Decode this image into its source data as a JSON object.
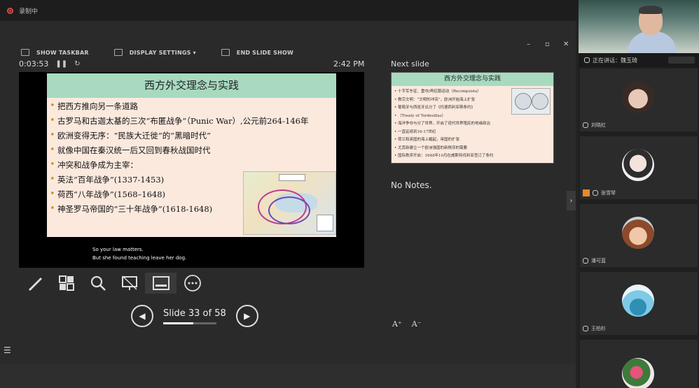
{
  "topbar": {
    "title": "录制中"
  },
  "toolbar": {
    "show_taskbar": "SHOW TASKBAR",
    "display_settings": "DISPLAY SETTINGS ▾",
    "end_slide_show": "END SLIDE SHOW"
  },
  "timer": {
    "elapsed": "0:03:53",
    "pause": "❚❚",
    "reset": "↻",
    "clock": "2:42 PM"
  },
  "slide": {
    "title": "西方外交理念与实践",
    "bullets": [
      "把西方推向另一条道路",
      "古罗马和古迦太基的三次“布匿战争”（Punic War）,公元前264-146年",
      "欧洲变得无序：“民族大迁徙”的“黑暗时代”",
      "就像中国在秦汉统一后又回到春秋战国时代",
      "冲突和战争成为主宰：",
      "英法“百年战争”(1337-1453)",
      "荷西“八年战争”(1568–1648)",
      "神圣罗马帝国的“三十年战争”(1618-1648)"
    ],
    "subtitle_line1": "So your law matters.",
    "subtitle_line2": "But she found teaching leave her dog."
  },
  "next": {
    "label": "Next slide",
    "title": "西方外交理念与实践",
    "lines": [
      "• 十字军东征、重夺/再征服运动（Reconquista）",
      "• 教宗文明：“文明的冲突”，欧洲开始海上扩张",
      "• 葡萄牙与西班牙瓜分了《托德西利亚斯条约》",
      "• （Treaty of Tordesillas）",
      "• 海洋争夺与分了世界，开启了现代世界殖民的地缘政治",
      "• 一直延续到16-17世纪",
      "• 荷兰和英国的海上崛起，帝国的扩张",
      "• 尤其新建立一个欧洲强国的新秩序的需要",
      "• 国际秩序开启：1648年10月在威斯特伐利亚签订了条约"
    ],
    "notes": "No Notes."
  },
  "navigation": {
    "prev": "◀",
    "next": "▶",
    "counter": "Slide 33 of 58",
    "current": 33,
    "total": 58
  },
  "font": {
    "increase": "A⁺",
    "decrease": "A⁻"
  },
  "participants": {
    "speaking": "正在讲话：魏玉琦",
    "names": [
      "刘晓红",
      "张雪琴",
      "潘可蓝",
      "王柏杉"
    ]
  },
  "colors": {
    "accent_title": "#a8dac0",
    "slide_bg": "#fbe9de",
    "bullet": "#c89a1a"
  }
}
